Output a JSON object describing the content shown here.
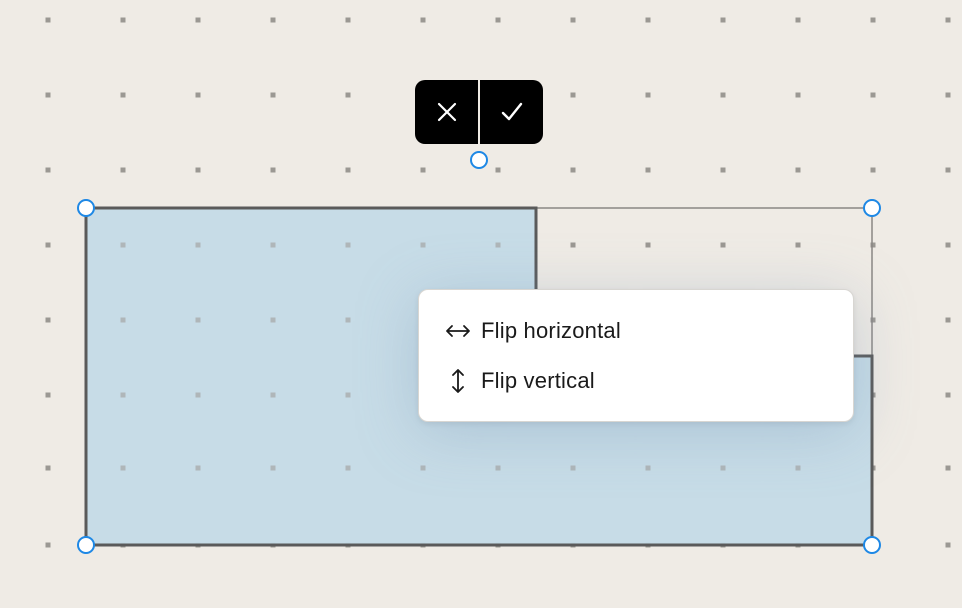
{
  "toolbar": {
    "cancel_icon": "close-icon",
    "confirm_icon": "check-icon"
  },
  "context_menu": {
    "items": [
      {
        "label": "Flip horizontal",
        "icon": "arrow-left-right-icon"
      },
      {
        "label": "Flip vertical",
        "icon": "arrow-up-down-icon"
      }
    ]
  },
  "colors": {
    "canvas_background": "#efebe5",
    "selection_fill": "#c4dbe7",
    "handle_stroke": "#1e88e5",
    "shape_stroke": "#555555",
    "grid_dot": "#9b9893"
  }
}
